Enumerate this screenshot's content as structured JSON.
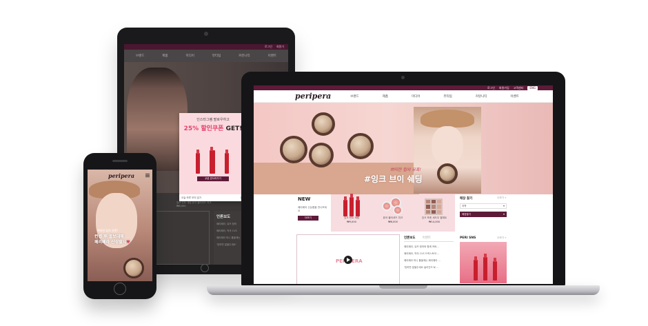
{
  "laptop": {
    "brand": "peripera",
    "utility": [
      "로그인",
      "회원가입",
      "고객센터",
      "ENG"
    ],
    "menu": [
      "브랜드",
      "제품",
      "미디어",
      "뷰티팁",
      "커뮤니티",
      "이벤트"
    ],
    "hero": {
      "kicker": "쁘띠한 립의 유혹!",
      "title": "#잉크 브이 쉐딩"
    },
    "new_section": {
      "title": "NEW",
      "desc": "페리페라 신상품을 만나보세요",
      "button": "더보기",
      "products": [
        {
          "name": "잉크 틴트 세럼",
          "price": "₩9,000"
        },
        {
          "name": "퓨어 블러셔드 치크",
          "price": "₩8,000"
        },
        {
          "name": "잉크 포켓 섀도우 팔레트",
          "price": "₩14,000"
        }
      ]
    },
    "store_finder": {
      "title": "매장 찾기",
      "more": "더보기 +",
      "region_select": "지역",
      "button": "매장찾기"
    },
    "video": {
      "brand": "PERIPERA"
    },
    "news": {
      "tabs": [
        "언론보도",
        "이벤트"
      ],
      "items": [
        "페리페라, 뮤즈 청하와 함께 커버...",
        "페리페라, 약국 CVS 드럭스토어 ...",
        "페리페라 미니 틀을깨는 페리페라 ...",
        "'빙하면 말을주세요 솔리안드'로 ..."
      ]
    },
    "sns": {
      "title": "PERI SNS",
      "more": "더보기 +"
    }
  },
  "tablet": {
    "utility": [
      "로그인",
      "회원가"
    ],
    "menu": [
      "브랜드",
      "제품",
      "미디어",
      "뷰티팁",
      "커뮤니티",
      "이벤트"
    ],
    "popup": {
      "line1": "인스타그램 팔로우하고",
      "discount": "25% 할인쿠폰",
      "get": "GET!",
      "button": "쿠폰 받으러가기",
      "footer_left": "오늘 하루 보지 않기",
      "footer_right": "닫기"
    },
    "products_text": "잉크 틴트 세럼   퓨어 블러셔드 치크",
    "price": "₩8,000",
    "news": {
      "title": "언론보도",
      "items": [
        "페리페라, 뮤즈 청하",
        "페리페라, 약국 CVS",
        "페리페라 미니 틀을깨는",
        "'빙하면 말을주세요'"
      ]
    }
  },
  "phone": {
    "brand": "peripera",
    "copy1": "쁘띠한 립의 유혹!",
    "copy2": "컨셉 후 꿀보대해",
    "copy3": "페리페라 산성할시"
  },
  "colors": {
    "brand_dark": "#5e1a39",
    "accent_pink": "#e2456a",
    "pink_bg": "#f7dce0"
  }
}
